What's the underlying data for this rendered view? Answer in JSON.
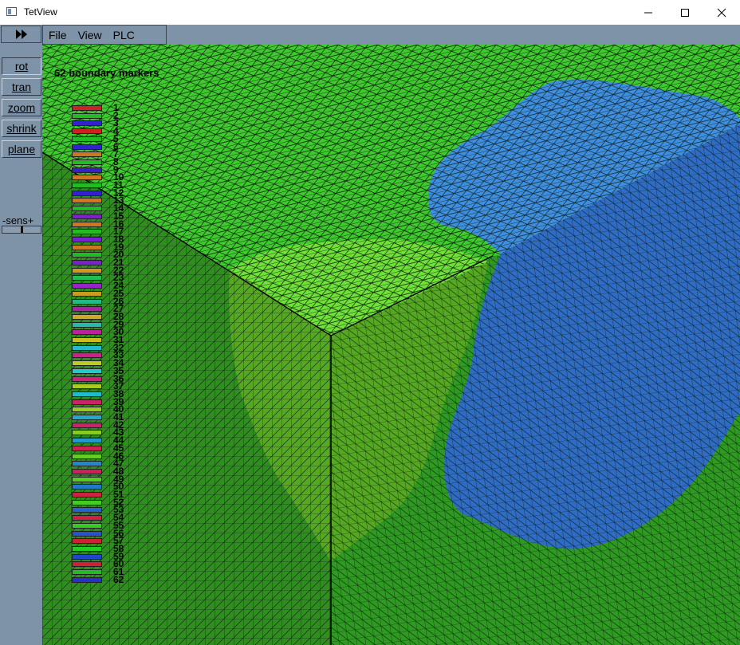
{
  "window": {
    "title": "TetView",
    "controls": [
      "minimize-icon",
      "maximize-icon",
      "close-icon"
    ]
  },
  "toolbar": {
    "play_icon": "fast-forward-icon",
    "menus": [
      "File",
      "View",
      "PLC"
    ]
  },
  "sidebar": {
    "buttons": [
      {
        "label": "rot",
        "active": true
      },
      {
        "label": "tran",
        "active": false
      },
      {
        "label": "zoom",
        "active": false
      },
      {
        "label": "shrink",
        "active": false
      },
      {
        "label": "plane",
        "active": false
      }
    ],
    "sens_label": "-sens+"
  },
  "legend": {
    "title": "62 boundary markers",
    "markers": [
      {
        "label": "1",
        "color": "#cc2222"
      },
      {
        "label": "2",
        "color": "#22bb22"
      },
      {
        "label": "3",
        "color": "#3322cc"
      },
      {
        "label": "4",
        "color": "#cc2222"
      },
      {
        "label": "5",
        "color": "#22bb22"
      },
      {
        "label": "6",
        "color": "#3322cc"
      },
      {
        "label": "7",
        "color": "#cc7722"
      },
      {
        "label": "8",
        "color": "#22bb22"
      },
      {
        "label": "9",
        "color": "#3322cc"
      },
      {
        "label": "10",
        "color": "#cc7722"
      },
      {
        "label": "11",
        "color": "#22bb22"
      },
      {
        "label": "12",
        "color": "#3322cc"
      },
      {
        "label": "13",
        "color": "#cc7722"
      },
      {
        "label": "14",
        "color": "#22bb22"
      },
      {
        "label": "15",
        "color": "#7722cc"
      },
      {
        "label": "16",
        "color": "#cc7722"
      },
      {
        "label": "17",
        "color": "#22bb22"
      },
      {
        "label": "18",
        "color": "#7722cc"
      },
      {
        "label": "19",
        "color": "#cc7722"
      },
      {
        "label": "20",
        "color": "#22bb22"
      },
      {
        "label": "21",
        "color": "#7722cc"
      },
      {
        "label": "22",
        "color": "#cc9922"
      },
      {
        "label": "23",
        "color": "#22bb55"
      },
      {
        "label": "24",
        "color": "#9922cc"
      },
      {
        "label": "25",
        "color": "#cc9922"
      },
      {
        "label": "26",
        "color": "#22bb88"
      },
      {
        "label": "27",
        "color": "#aa22aa"
      },
      {
        "label": "28",
        "color": "#ccaa22"
      },
      {
        "label": "29",
        "color": "#22bbaa"
      },
      {
        "label": "30",
        "color": "#bb2299"
      },
      {
        "label": "31",
        "color": "#ccbb22"
      },
      {
        "label": "32",
        "color": "#22bbcc"
      },
      {
        "label": "33",
        "color": "#cc2288"
      },
      {
        "label": "34",
        "color": "#bbcc22"
      },
      {
        "label": "35",
        "color": "#22cccc"
      },
      {
        "label": "36",
        "color": "#cc2277"
      },
      {
        "label": "37",
        "color": "#aacc22"
      },
      {
        "label": "38",
        "color": "#22bbcc"
      },
      {
        "label": "39",
        "color": "#cc2266"
      },
      {
        "label": "40",
        "color": "#99cc22"
      },
      {
        "label": "41",
        "color": "#22aacc"
      },
      {
        "label": "42",
        "color": "#cc2266"
      },
      {
        "label": "43",
        "color": "#88cc22"
      },
      {
        "label": "44",
        "color": "#2299cc"
      },
      {
        "label": "45",
        "color": "#cc2255"
      },
      {
        "label": "46",
        "color": "#66cc22"
      },
      {
        "label": "47",
        "color": "#2288cc"
      },
      {
        "label": "48",
        "color": "#cc2255"
      },
      {
        "label": "49",
        "color": "#55cc22"
      },
      {
        "label": "50",
        "color": "#2277cc"
      },
      {
        "label": "51",
        "color": "#cc2244"
      },
      {
        "label": "52",
        "color": "#44cc22"
      },
      {
        "label": "53",
        "color": "#2266cc"
      },
      {
        "label": "54",
        "color": "#cc2244"
      },
      {
        "label": "55",
        "color": "#33cc22"
      },
      {
        "label": "56",
        "color": "#2255cc"
      },
      {
        "label": "57",
        "color": "#cc2233"
      },
      {
        "label": "58",
        "color": "#22cc22"
      },
      {
        "label": "59",
        "color": "#2244cc"
      },
      {
        "label": "60",
        "color": "#cc2233"
      },
      {
        "label": "61",
        "color": "#22bb22"
      },
      {
        "label": "62",
        "color": "#2233cc"
      }
    ]
  },
  "scene": {
    "colors": {
      "top_face": "#3fcb2f",
      "left_face": "#2e8f1f",
      "right_face": "#2e9a22",
      "blue_top": "#3f8fe0",
      "blue_side": "#2f6cc4",
      "lime_top": "#6fe23a",
      "lime_side": "#55a822",
      "mesh_line": "#0a140a"
    }
  }
}
